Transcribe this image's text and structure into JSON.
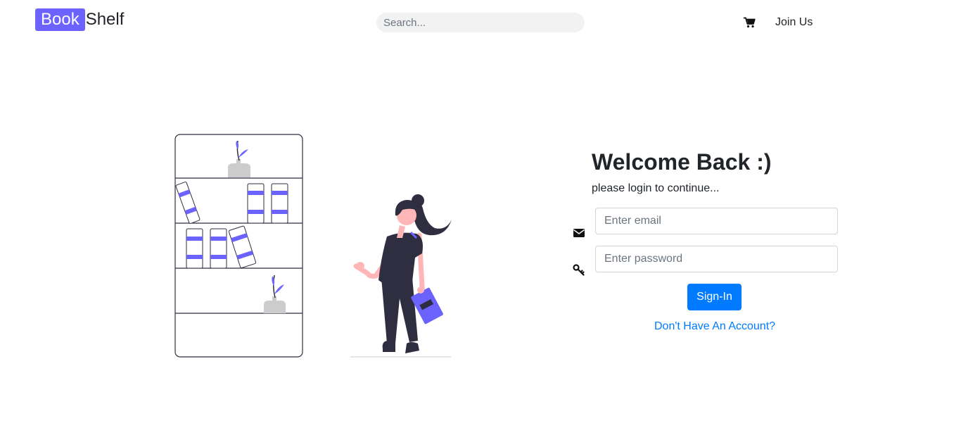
{
  "brand": {
    "part1": "Book",
    "part2": "Shelf"
  },
  "nav": {
    "search_placeholder": "Search...",
    "cart_icon": "shopping-cart-icon",
    "join_label": "Join Us"
  },
  "login": {
    "title": "Welcome Back :)",
    "subtitle": "please login to continue...",
    "email_icon": "envelope-icon",
    "email_placeholder": "Enter email",
    "password_icon": "key-icon",
    "password_placeholder": "Enter password",
    "submit_label": "Sign-In",
    "register_link": "Don't Have An Account?"
  },
  "colors": {
    "brand_accent": "#6c63ff",
    "primary": "#007bff",
    "illustration_dark": "#2f2e41",
    "skin": "#ffb6b6"
  }
}
